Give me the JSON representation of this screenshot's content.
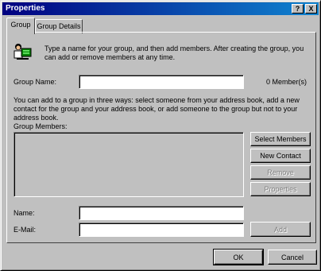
{
  "window": {
    "title": "Properties"
  },
  "titlebar_buttons": {
    "help": "?",
    "close": "X"
  },
  "tabs": [
    {
      "label": "Group",
      "active": true
    },
    {
      "label": "Group Details",
      "active": false
    }
  ],
  "intro_text": "Type a name for your group, and then add members. After creating the group, you can add or remove members at any time.",
  "group_name": {
    "label": "Group Name:",
    "value": "",
    "member_count": "0 Member(s)"
  },
  "info_text": "You can add to a group in three ways: select someone from your address book, add a new contact for the group and your address book, or add someone to the group but not to your address book.",
  "members": {
    "label": "Group Members:"
  },
  "buttons": {
    "select_members": "Select Members",
    "new_contact": "New Contact",
    "remove": "Remove",
    "properties": "Properties",
    "add": "Add"
  },
  "name_field": {
    "label": "Name:",
    "value": ""
  },
  "email_field": {
    "label": "E-Mail:",
    "value": ""
  },
  "footer": {
    "ok": "OK",
    "cancel": "Cancel"
  },
  "icons": {
    "group": "group-people-icon"
  }
}
